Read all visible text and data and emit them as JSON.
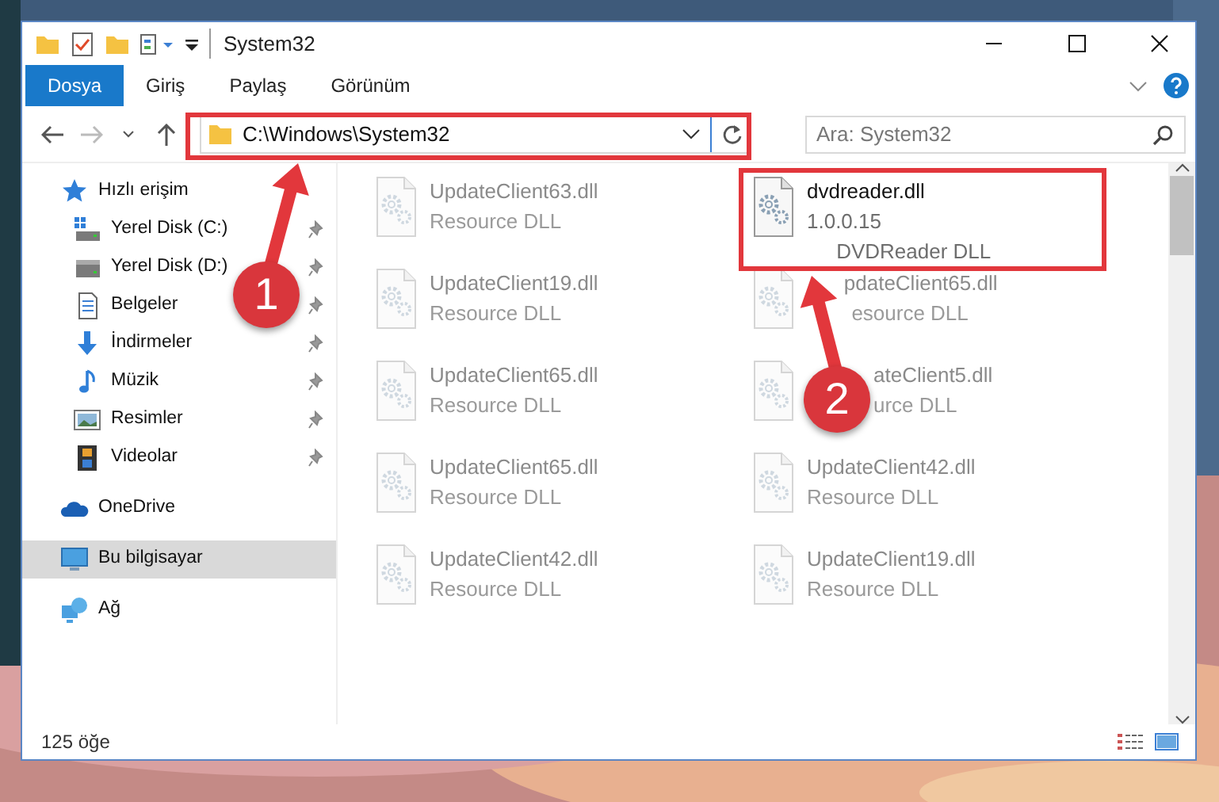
{
  "window": {
    "title": "System32"
  },
  "ribbon_tabs": [
    {
      "label": "Dosya",
      "selected": true
    },
    {
      "label": "Giriş",
      "selected": false
    },
    {
      "label": "Paylaş",
      "selected": false
    },
    {
      "label": "Görünüm",
      "selected": false
    }
  ],
  "address": {
    "path": "C:\\Windows\\System32"
  },
  "search": {
    "placeholder": "Ara: System32"
  },
  "sidebar": {
    "items": [
      {
        "label": "Hızlı erişim",
        "kind": "star",
        "selected": false,
        "children": [
          {
            "label": "Yerel Disk (C:)",
            "kind": "drive-windows",
            "pinned": true
          },
          {
            "label": "Yerel Disk (D:)",
            "kind": "drive",
            "pinned": true
          },
          {
            "label": "Belgeler",
            "kind": "document",
            "pinned": true
          },
          {
            "label": "İndirmeler",
            "kind": "download",
            "pinned": true
          },
          {
            "label": "Müzik",
            "kind": "music",
            "pinned": true
          },
          {
            "label": "Resimler",
            "kind": "pictures",
            "pinned": true
          },
          {
            "label": "Videolar",
            "kind": "film",
            "pinned": true
          }
        ]
      },
      {
        "label": "OneDrive",
        "kind": "cloud",
        "selected": false
      },
      {
        "label": "Bu bilgisayar",
        "kind": "monitor",
        "selected": true
      },
      {
        "label": "Ağ",
        "kind": "network",
        "selected": false
      }
    ]
  },
  "files": [
    {
      "name": "UpdateClient63.dll",
      "lines": [
        "Resource DLL"
      ],
      "faded": true
    },
    {
      "name": "dvdreader.dll",
      "lines": [
        "1.0.0.15",
        "DVDReader DLL"
      ],
      "faded": false
    },
    {
      "name": "UpdateClient19.dll",
      "lines": [
        "Resource DLL"
      ],
      "faded": true
    },
    {
      "name": "pdateClient65.dll",
      "lines": [
        "esource DLL"
      ],
      "faded": true
    },
    {
      "name": "UpdateClient65.dll",
      "lines": [
        "Resource DLL"
      ],
      "faded": true
    },
    {
      "name": "ateClient5.dll",
      "lines": [
        "urce DLL"
      ],
      "faded": true
    },
    {
      "name": "UpdateClient65.dll",
      "lines": [
        "Resource DLL"
      ],
      "faded": true
    },
    {
      "name": "UpdateClient42.dll",
      "lines": [
        "Resource DLL"
      ],
      "faded": true
    },
    {
      "name": "UpdateClient42.dll",
      "lines": [
        "Resource DLL"
      ],
      "faded": true
    },
    {
      "name": "UpdateClient19.dll",
      "lines": [
        "Resource DLL"
      ],
      "faded": true
    }
  ],
  "status_bar": {
    "count": "125 öğe"
  },
  "annotations": [
    {
      "number": "1"
    },
    {
      "number": "2"
    }
  ]
}
